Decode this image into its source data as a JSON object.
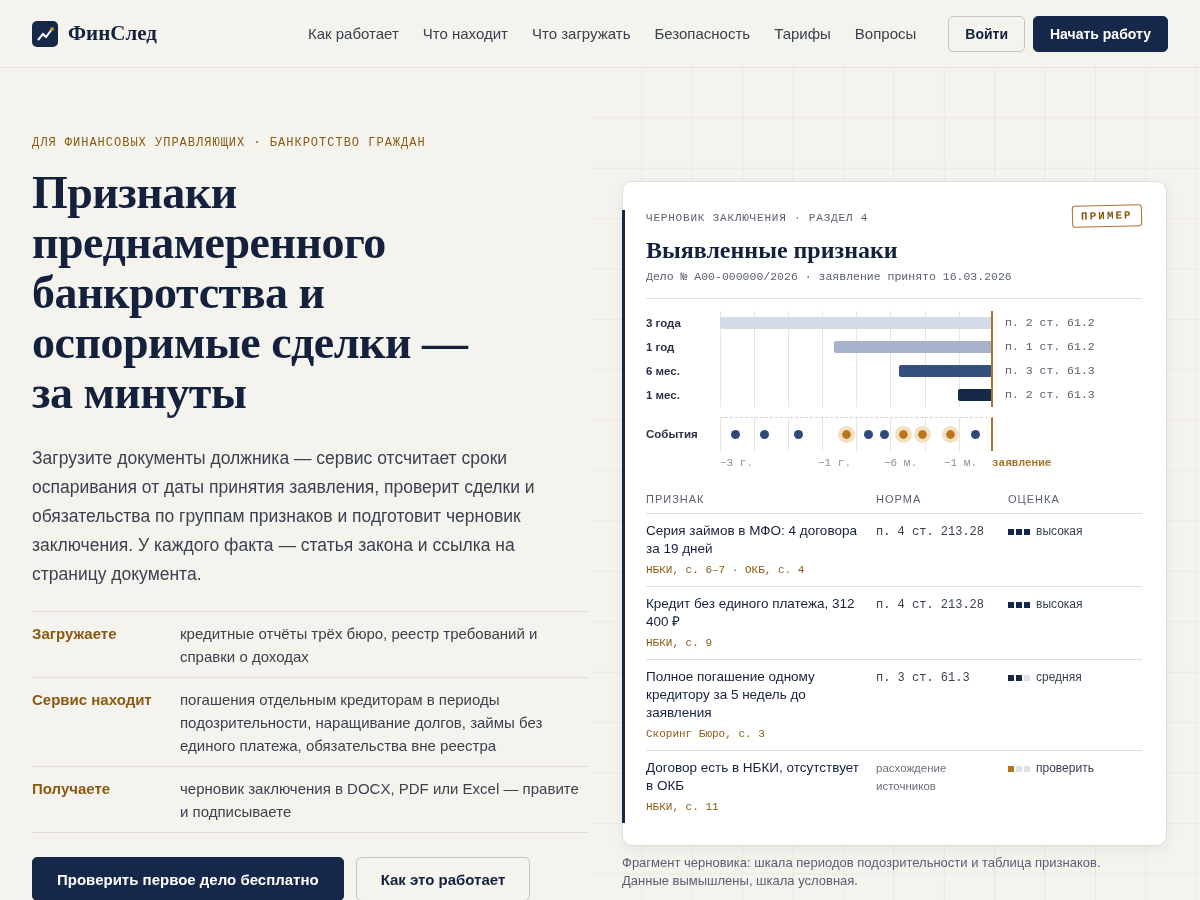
{
  "header": {
    "logo": "ФинСлед",
    "nav": [
      "Как работает",
      "Что находит",
      "Что загружать",
      "Безопасность",
      "Тарифы",
      "Вопросы"
    ],
    "login": "Войти",
    "cta": "Начать работу"
  },
  "hero": {
    "eyebrow": "ДЛЯ ФИНАНСОВЫХ УПРАВЛЯЮЩИХ · БАНКРОТСТВО ГРАЖДАН",
    "title": "Признаки преднамеренного банкротства и оспоримые сделки — за минуты",
    "lead": "Загрузите документы должника — сервис отсчитает сроки оспаривания от даты принятия заявления, проверит сделки и обязательства по группам признаков и подготовит черновик заключения. У каждого факта — статья закона и ссылка на страницу документа.",
    "facts": [
      {
        "term": "Загружаете",
        "text": "кредитные отчёты трёх бюро, реестр требований и справки о доходах"
      },
      {
        "term": "Сервис находит",
        "text": "погашения отдельным кредиторам в периоды подозрительности, наращивание долгов, займы без единого платежа, обязательства вне реестра"
      },
      {
        "term": "Получаете",
        "text": "черновик заключения в DOCX, PDF или Excel — правите и подписываете"
      }
    ],
    "buttons": [
      "Проверить первое дело бесплатно",
      "Как это работает"
    ]
  },
  "card": {
    "eyebrow": "ЧЕРНОВИК ЗАКЛЮЧЕНИЯ · РАЗДЕЛ 4",
    "badge": "ПРИМЕР",
    "title": "Выявленные признаки",
    "subtitle": "Дело № А00-000000/2026 · заявление принято 16.03.2026",
    "timeline": {
      "bars": [
        {
          "label": "3 года",
          "level": 1,
          "color": "#d5dce8",
          "ref": "п. 2 ст. 61.2"
        },
        {
          "label": "1 год",
          "level": 0.58,
          "color": "#a6b3cb",
          "ref": "п. 1 ст. 61.2"
        },
        {
          "label": "6 мес.",
          "level": 0.34,
          "color": "#34507e",
          "ref": "п. 3 ст. 61.3"
        },
        {
          "label": "1 мес.",
          "level": 0.12,
          "color": "#16284a",
          "ref": "п. 2 ст. 61.3"
        }
      ],
      "events_label": "События",
      "events": [
        {
          "color": "#2f4a7a",
          "flagged": false
        },
        {
          "color": "#2f4a7a",
          "flagged": false
        },
        {
          "color": "#2f4a7a",
          "flagged": false
        },
        {
          "color": "#b8751a",
          "flagged": true
        },
        {
          "color": "#2f4a7a",
          "flagged": false
        },
        {
          "color": "#2f4a7a",
          "flagged": false
        },
        {
          "color": "#b8751a",
          "flagged": true
        },
        {
          "color": "#b8751a",
          "flagged": true
        },
        {
          "color": "#b8751a",
          "flagged": true
        },
        {
          "color": "#2f4a7a",
          "flagged": false
        }
      ],
      "ticks": [
        {
          "label": "−3 г.",
          "kind": "offset"
        },
        {
          "label": "−1 г.",
          "kind": "offset"
        },
        {
          "label": "−6 м.",
          "kind": "offset"
        },
        {
          "label": "−1 м.",
          "kind": "offset"
        },
        {
          "label": "заявление",
          "kind": "filing"
        }
      ]
    },
    "table": {
      "columns": [
        "ПРИЗНАК",
        "НОРМА",
        "ОЦЕНКА"
      ],
      "rows": [
        {
          "sign": "Серия займов в МФО: 4 договора за 19 дней",
          "source": "НБКИ, с. 6–7 · ОКБ, с. 4",
          "norm": {
            "text": "п. 4 ст. 213.28",
            "kind": "article"
          },
          "rating": {
            "stars": 3,
            "color": "#16284a",
            "label": "высокая"
          }
        },
        {
          "sign": "Кредит без единого платежа, 312 400 ₽",
          "source": "НБКИ, с. 9",
          "norm": {
            "text": "п. 4 ст. 213.28",
            "kind": "article"
          },
          "rating": {
            "stars": 3,
            "color": "#16284a",
            "label": "высокая"
          }
        },
        {
          "sign": "Полное погашение одному кредитору за 5 недель до заявления",
          "source": "Скоринг Бюро, с. 3",
          "norm": {
            "text": "п. 3 ст. 61.3",
            "kind": "article"
          },
          "rating": {
            "stars": 2,
            "color": "#16284a",
            "label": "средняя"
          }
        },
        {
          "sign": "Договор есть в НБКИ, отсутствует в ОКБ",
          "source": "НБКИ, с. 11",
          "norm": {
            "text": "расхождение источников",
            "kind": "note"
          },
          "rating": {
            "stars": 1,
            "color": "#b8751a",
            "label": "проверить"
          }
        }
      ]
    }
  },
  "caption": "Фрагмент черновика: шкала периодов подозрительности и таблица признаков. Данные вымышлены, шкала условная."
}
